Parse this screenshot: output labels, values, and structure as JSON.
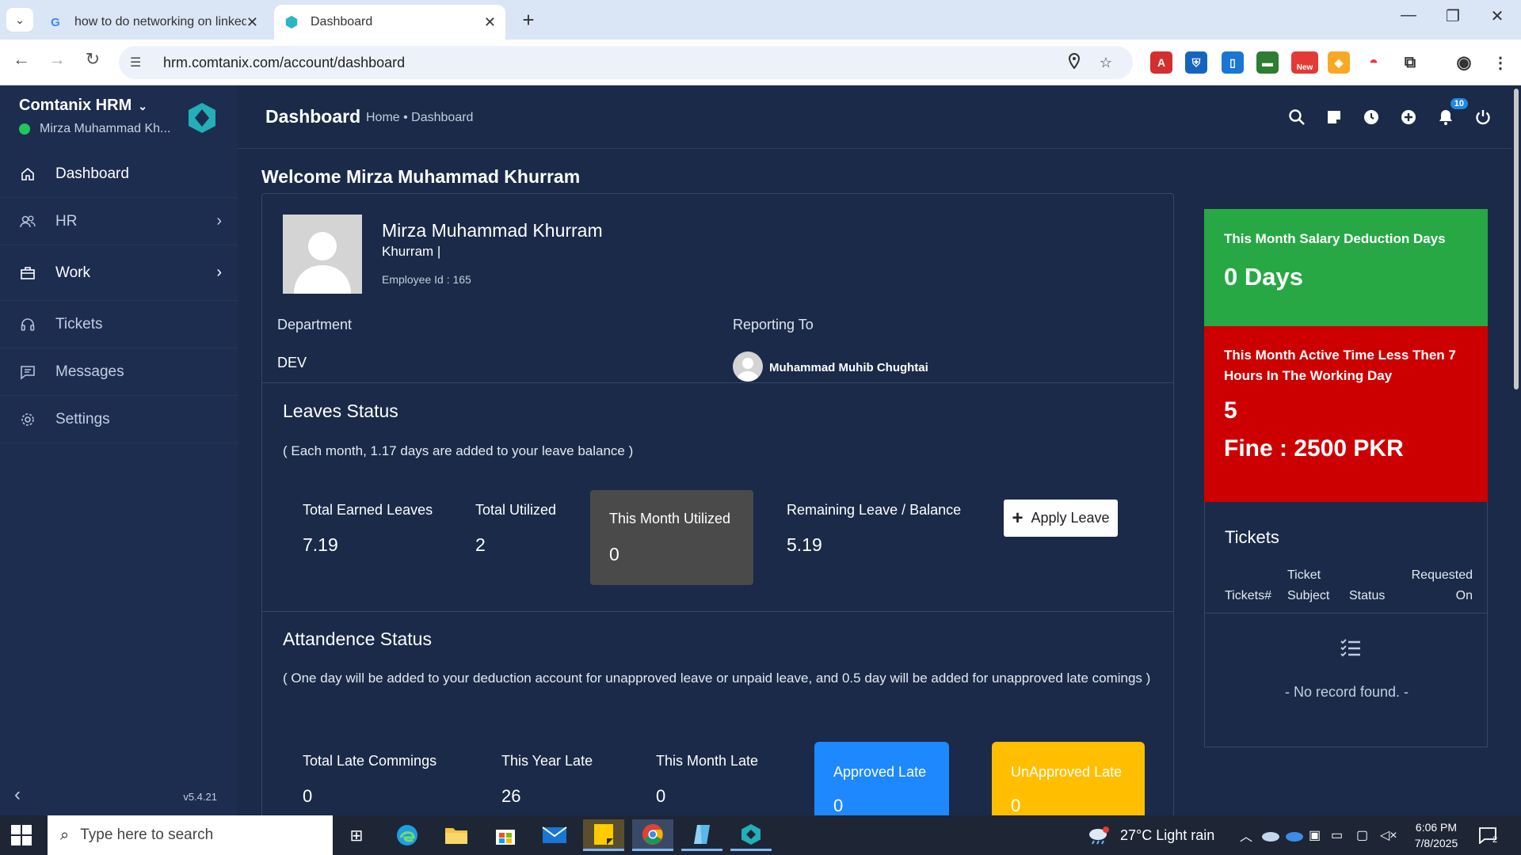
{
  "browser": {
    "tabs": [
      {
        "title": "how to do networking on linkedi",
        "favicon": "G"
      },
      {
        "title": "Dashboard",
        "favicon": "hex-logo"
      }
    ],
    "url": "hrm.comtanix.com/account/dashboard",
    "extension_badge": "New"
  },
  "sidebar": {
    "brand": "Comtanix HRM",
    "user": "Mirza Muhammad Kh...",
    "items": [
      {
        "label": "Dashboard",
        "icon": "home-icon"
      },
      {
        "label": "HR",
        "icon": "users-icon"
      },
      {
        "label": "Work",
        "icon": "briefcase-icon"
      },
      {
        "label": "Tickets",
        "icon": "headset-icon"
      },
      {
        "label": "Messages",
        "icon": "message-icon"
      },
      {
        "label": "Settings",
        "icon": "gear-icon"
      }
    ],
    "version": "v5.4.21"
  },
  "header": {
    "title": "Dashboard",
    "breadcrumb": "Home • Dashboard",
    "notification_count": "10"
  },
  "welcome": "Welcome Mirza Muhammad Khurram",
  "profile": {
    "name": "Mirza Muhammad Khurram",
    "nickname": "Khurram |",
    "employee_id": "Employee Id : 165",
    "department_label": "Department",
    "department": "DEV",
    "reporting_label": "Reporting To",
    "reporting_to": "Muhammad Muhib Chughtai"
  },
  "leaves": {
    "title": "Leaves Status",
    "note": "( Each month, 1.17 days are added to your leave balance )",
    "earned_label": "Total Earned Leaves",
    "earned": "7.19",
    "utilized_label": "Total Utilized",
    "utilized": "2",
    "month_label": "This Month Utilized",
    "month": "0",
    "remaining_label": "Remaining Leave / Balance",
    "remaining": "5.19",
    "apply_label": "Apply Leave"
  },
  "attendance": {
    "title": "Attandence Status",
    "note": "( One day will be added to your deduction account for unapproved leave or unpaid leave, and 0.5 day will be added for unapproved late comings )",
    "total_late_label": "Total Late Commings",
    "total_late": "0",
    "year_late_label": "This Year Late",
    "year_late": "26",
    "month_late_label": "This Month Late",
    "month_late": "0",
    "approved_label": "Approved Late",
    "approved": "0",
    "unapproved_label": "UnApproved Late",
    "unapproved": "0"
  },
  "salary": {
    "label": "This Month Salary Deduction Days",
    "value": "0 Days"
  },
  "active_time": {
    "label": "This Month Active Time Less Then 7 Hours In The Working Day",
    "value": "5",
    "fine": "Fine : 2500 PKR"
  },
  "tickets": {
    "title": "Tickets",
    "columns": [
      "Tickets#",
      "Ticket Subject",
      "Status",
      "Requested On"
    ],
    "empty": "- No record found. -"
  },
  "taskbar": {
    "search_placeholder": "Type here to search",
    "weather": "27°C  Light rain",
    "time": "6:06 PM",
    "date": "7/8/2025",
    "notif_count": "2"
  },
  "colors": {
    "background": "#1a2a48",
    "sidebar": "#1d2d50",
    "green": "#27a844",
    "red": "#cc0000",
    "approved_blue": "#1e88ff",
    "unapproved_yellow": "#ffbf00",
    "month_box_grey": "#4a4a4a"
  }
}
